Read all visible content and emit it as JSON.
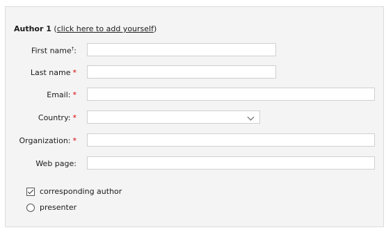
{
  "author": {
    "heading_label": "Author 1",
    "add_yourself_link": "click here to add yourself",
    "fields": {
      "first_name": {
        "label": "First name",
        "sup": "†",
        "suffix": ":",
        "value": ""
      },
      "last_name": {
        "label": "Last name",
        "required_mark": "*",
        "value": ""
      },
      "email": {
        "label": "Email:",
        "required_mark": "*",
        "value": ""
      },
      "country": {
        "label": "Country:",
        "required_mark": "*",
        "value": ""
      },
      "organization": {
        "label": "Organization:",
        "required_mark": "*",
        "value": ""
      },
      "web_page": {
        "label": "Web page:",
        "value": ""
      }
    },
    "options": {
      "corresponding_author": {
        "label": "corresponding author",
        "checked": true
      },
      "presenter": {
        "label": "presenter",
        "selected": false
      }
    }
  },
  "colors": {
    "required": "#d40000",
    "panel_bg": "#f4f4f4"
  }
}
